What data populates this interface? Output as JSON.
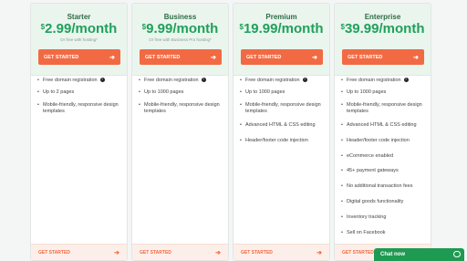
{
  "plans": [
    {
      "name": "Starter",
      "currency": "$",
      "amount": "2.99",
      "period": "/month",
      "note": "Or free with hosting*",
      "cta": "GET STARTED",
      "features": [
        "Free domain registration",
        "Up to 2 pages",
        "Mobile-friendly, responsive design templates"
      ],
      "footer_cta": "GET STARTED"
    },
    {
      "name": "Business",
      "currency": "$",
      "amount": "9.99",
      "period": "/month",
      "note": "Or free with Business Pro hosting*",
      "cta": "GET STARTED",
      "features": [
        "Free domain registration",
        "Up to 1000 pages",
        "Mobile-friendly, responsive design templates"
      ],
      "footer_cta": "GET STARTED"
    },
    {
      "name": "Premium",
      "currency": "$",
      "amount": "19.99",
      "period": "/month",
      "note": "",
      "cta": "GET STARTED",
      "features": [
        "Free domain registration",
        "Up to 1000 pages",
        "Mobile-friendly, responsive design templates",
        "Advanced HTML & CSS editing",
        "Header/footer code injection"
      ],
      "footer_cta": "GET STARTED"
    },
    {
      "name": "Enterprise",
      "currency": "$",
      "amount": "39.99",
      "period": "/month",
      "note": "",
      "cta": "GET STARTED",
      "features": [
        "Free domain registration",
        "Up to 1000 pages",
        "Mobile-friendly, responsive design templates",
        "Advanced HTML & CSS editing",
        "Header/footer code injection",
        "eCommerce enabled",
        "45+ payment gateways",
        "No additional transaction fees",
        "Digital goods functionality",
        "Inventory tracking",
        "Sell on Facebook"
      ],
      "footer_cta": "GET STARTED"
    }
  ],
  "chat": {
    "label": "Chat now"
  },
  "colors": {
    "accent": "#f26a43",
    "price": "#1fa15a",
    "header_bg": "#eaf5ee",
    "chat": "#1e9a52"
  },
  "icons": {
    "help": "question-circle-icon",
    "arrow": "arrow-right-icon",
    "chat": "chat-bubble-icon"
  }
}
